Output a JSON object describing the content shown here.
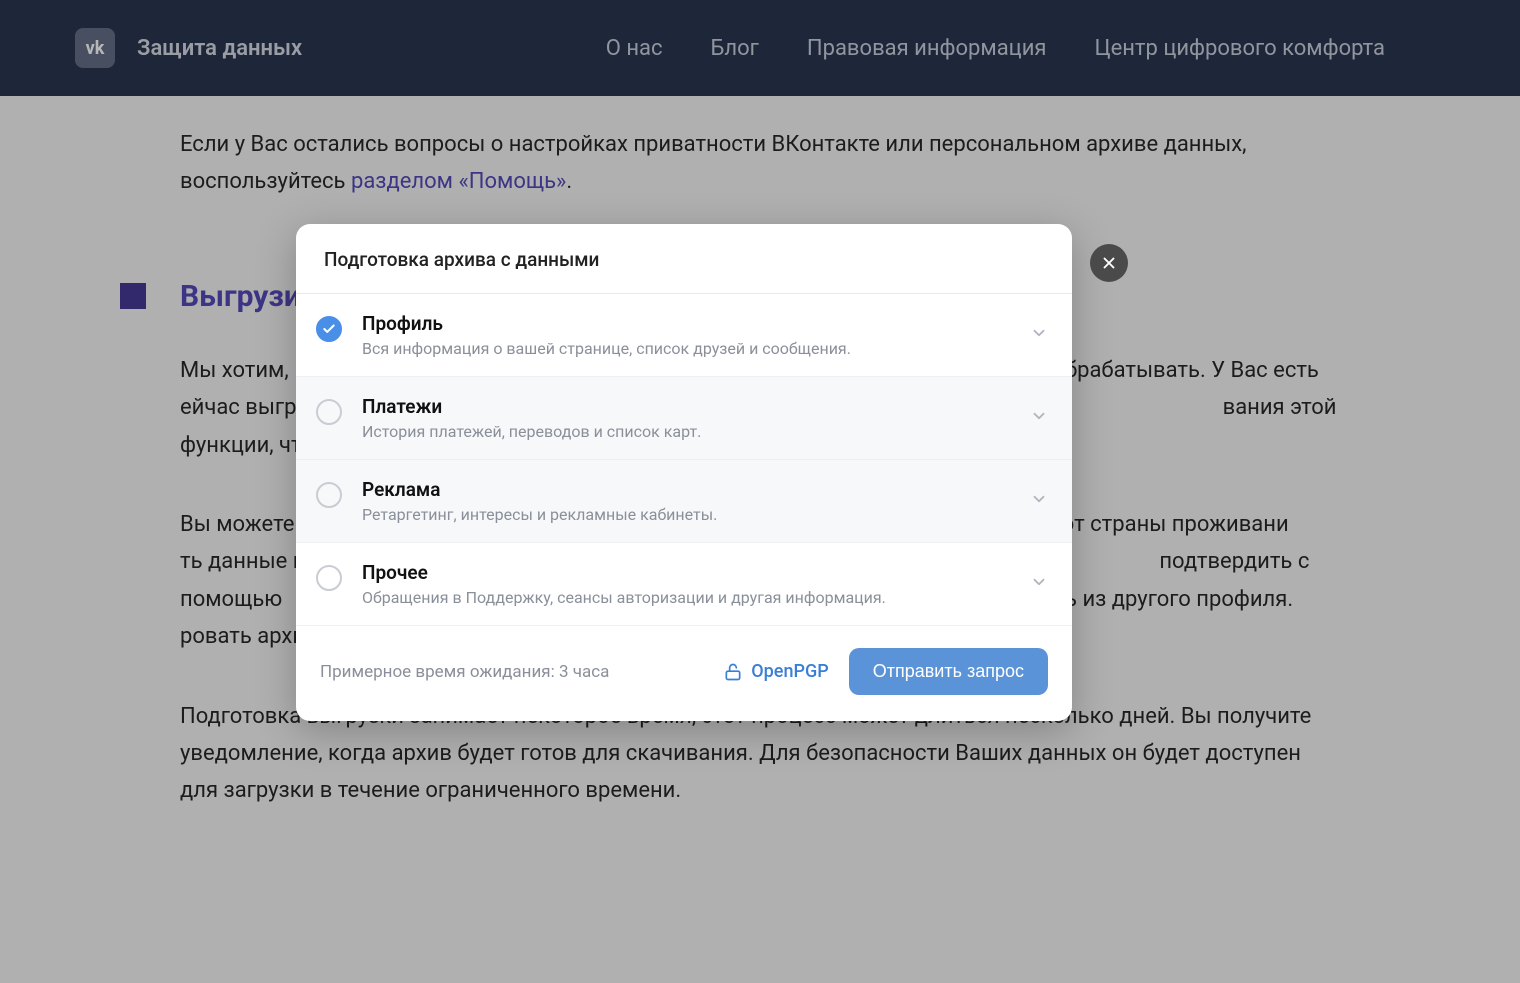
{
  "header": {
    "brand": "Защита данных",
    "logo_text": "vk",
    "nav": [
      "О нас",
      "Блог",
      "Правовая информация",
      "Центр цифрового комфорта"
    ]
  },
  "content": {
    "intro_text": "Если у Вас остались вопросы о настройках приватности ВКонтакте или персональном архиве данных, воспользуйтесь ",
    "intro_link": "разделом «Помощь»",
    "intro_suffix": ".",
    "section_title": "Выгрузи",
    "para1": "Мы хотим,                                                                                                                                    или обрабатывать. У Вас есть                                                                                                                                    ейчас выгрузка работает в                                                                                                                                            вания этой функции, чт",
    "para2": "Вы можете                                                                                                                                    имо от страны проживани                                                                                                                                    ть данные в соответстви                                                                                                                                    подтвердить с помощью                                                                                                                                    ткрыть из другого профиля.                                                                                                                                    ровать архив с помощью",
    "para3": "Подготовка выгрузки занимает некоторое время, этот процесс может длиться несколько дней. Вы получите уведомление, когда архив будет готов для скачивания. Для безопасности Ваших данных он будет доступен для загрузки в течение ограниченного времени."
  },
  "modal": {
    "title": "Подготовка архива с данными",
    "options": [
      {
        "title": "Профиль",
        "sub": "Вся информация о вашей странице, список друзей и сообщения.",
        "checked": true
      },
      {
        "title": "Платежи",
        "sub": "История платежей, переводов и список карт.",
        "checked": false
      },
      {
        "title": "Реклама",
        "sub": "Ретаргетинг, интересы и рекламные кабинеты.",
        "checked": false
      },
      {
        "title": "Прочее",
        "sub": "Обращения в Поддержку, сеансы авторизации и другая информация.",
        "checked": false
      }
    ],
    "wait_text": "Примерное время ожидания: 3 часа",
    "pgp_label": "OpenPGP",
    "submit_label": "Отправить запрос"
  }
}
